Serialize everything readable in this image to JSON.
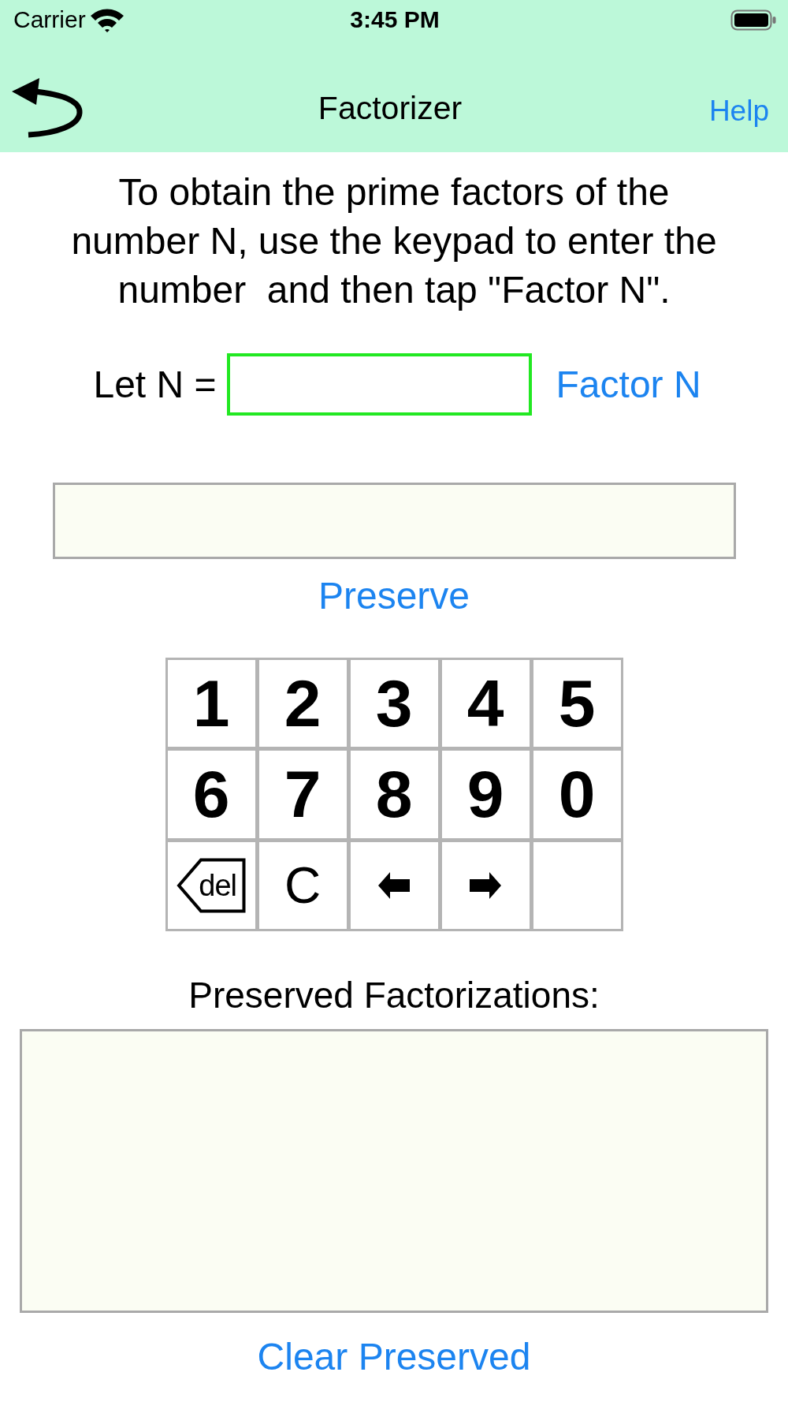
{
  "status_bar": {
    "carrier": "Carrier",
    "time": "3:45 PM"
  },
  "nav_bar": {
    "title": "Factorizer",
    "action": "Help"
  },
  "instructions": "To obtain the prime factors of the number N, use the keypad to enter the number  and then tap \"Factor N\".",
  "input_row": {
    "label": "Let N =",
    "button": "Factor N"
  },
  "preserve_button": "Preserve",
  "keypad": {
    "keys": [
      {
        "kind": "digit",
        "label": "1"
      },
      {
        "kind": "digit",
        "label": "2"
      },
      {
        "kind": "digit",
        "label": "3"
      },
      {
        "kind": "digit",
        "label": "4"
      },
      {
        "kind": "digit",
        "label": "5"
      },
      {
        "kind": "digit",
        "label": "6"
      },
      {
        "kind": "digit",
        "label": "7"
      },
      {
        "kind": "digit",
        "label": "8"
      },
      {
        "kind": "digit",
        "label": "9"
      },
      {
        "kind": "digit",
        "label": "0"
      },
      {
        "kind": "delete",
        "label": "del"
      },
      {
        "kind": "clear",
        "label": "C"
      },
      {
        "kind": "arrow_left"
      },
      {
        "kind": "arrow_right"
      },
      {
        "kind": "blank"
      }
    ]
  },
  "preserved": {
    "title": "Preserved Factorizations:",
    "clear_button": "Clear Preserved"
  }
}
